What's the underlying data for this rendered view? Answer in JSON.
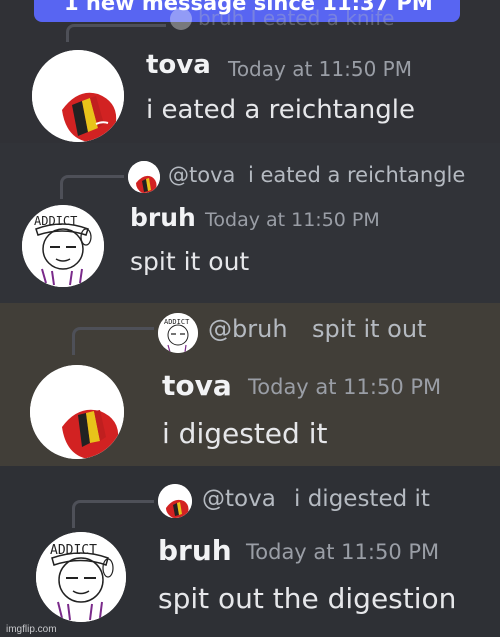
{
  "banner": {
    "text": "1 new message since 11:37 PM"
  },
  "messages": [
    {
      "reply": {
        "avatar": "tova-avatar",
        "mention": "",
        "text": "bruh I eated a knife",
        "faded": true
      },
      "author": "tova",
      "timestamp": "Today at 11:50 PM",
      "text": "i eated a reichtangle",
      "avatar": "tova-avatar"
    },
    {
      "reply": {
        "avatar": "tova-avatar",
        "mention": "@tova",
        "text": "i eated a reichtangle"
      },
      "author": "bruh",
      "timestamp": "Today at 11:50 PM",
      "text": "spit it out",
      "avatar": "bruh-avatar"
    },
    {
      "reply": {
        "avatar": "bruh-avatar",
        "mention": "@bruh",
        "text": "spit it out"
      },
      "author": "tova",
      "timestamp": "Today at 11:50 PM",
      "text": "i digested it",
      "avatar": "tova-avatar",
      "highlighted": true
    },
    {
      "reply": {
        "avatar": "tova-avatar",
        "mention": "@tova",
        "text": "i digested it"
      },
      "author": "bruh",
      "timestamp": "Today at 11:50 PM",
      "text": "spit out the digestion",
      "avatar": "bruh-avatar"
    }
  ],
  "watermark": "imgflip.com",
  "colors": {
    "background": "#313338",
    "highlight": "#413e38",
    "banner": "#5865f2",
    "username": "#f2f3f5",
    "timestamp": "#9a9ea6"
  }
}
